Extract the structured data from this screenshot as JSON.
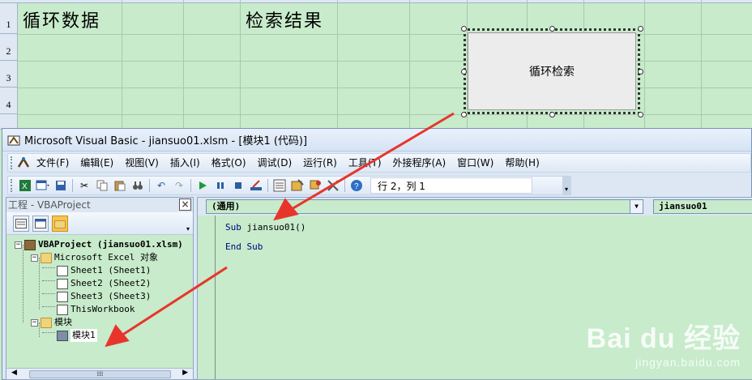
{
  "sheet": {
    "rows": [
      "1",
      "2",
      "3",
      "4"
    ],
    "a1": "循环数据",
    "c1": "检索结果",
    "button_label": "循环检索"
  },
  "window": {
    "title": "Microsoft Visual Basic - jiansuo01.xlsm - [模块1 (代码)]"
  },
  "menu": [
    "文件(F)",
    "编辑(E)",
    "视图(V)",
    "插入(I)",
    "格式(O)",
    "调试(D)",
    "运行(R)",
    "工具(T)",
    "外接程序(A)",
    "窗口(W)",
    "帮助(H)"
  ],
  "toolbar": {
    "position": "行 2，列 1"
  },
  "project": {
    "title": "工程 - VBAProject",
    "close": "×",
    "tree": {
      "root": "VBAProject (jiansuo01.xlsm)",
      "excel_objects": "Microsoft Excel 对象",
      "sheet1": "Sheet1 (Sheet1)",
      "sheet2": "Sheet2 (Sheet2)",
      "sheet3": "Sheet3 (Sheet3)",
      "workbook": "ThisWorkbook",
      "modules": "模块",
      "module1": "模块1"
    }
  },
  "code": {
    "object_combo": "(通用)",
    "proc_combo": "jiansuo01",
    "line1": "Sub jiansuo01()",
    "line2": "End Sub"
  },
  "watermark": {
    "logo": "Bai du 经验",
    "url": "jingyan.baidu.com"
  },
  "colors": {
    "sheet_bg": "#c7ebcb",
    "arrow": "#e8352b",
    "keyword": "#00007f"
  }
}
